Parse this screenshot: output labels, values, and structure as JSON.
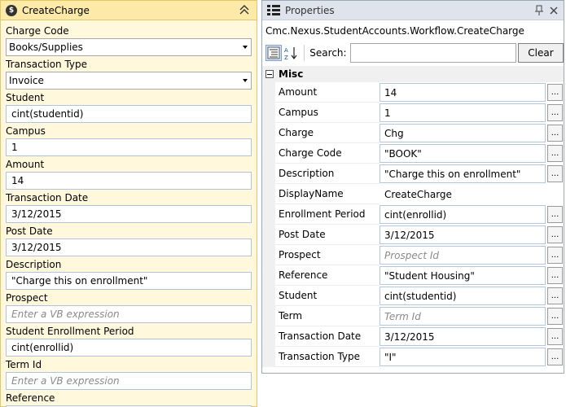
{
  "activity": {
    "title": "CreateCharge",
    "icon_letter": "$",
    "fields": [
      {
        "label": "Charge Code",
        "value": "Books/Supplies",
        "kind": "combo"
      },
      {
        "label": "Transaction Type",
        "value": "Invoice",
        "kind": "combo"
      },
      {
        "label": "Student",
        "value": "cint(studentid)",
        "kind": "text"
      },
      {
        "label": "Campus",
        "value": "1",
        "kind": "text"
      },
      {
        "label": "Amount",
        "value": "14",
        "kind": "text"
      },
      {
        "label": "Transaction Date",
        "value": "3/12/2015",
        "kind": "text"
      },
      {
        "label": "Post Date",
        "value": "3/12/2015",
        "kind": "text"
      },
      {
        "label": "Description",
        "value": "\"Charge this on enrollment\"",
        "kind": "text"
      },
      {
        "label": "Prospect",
        "value": "",
        "placeholder": "Enter a VB expression",
        "kind": "text"
      },
      {
        "label": "Student Enrollment Period",
        "value": "cint(enrollid)",
        "kind": "text"
      },
      {
        "label": "Term Id",
        "value": "",
        "placeholder": "Enter a VB expression",
        "kind": "text"
      },
      {
        "label": "Reference",
        "value": "\"Student Housing\"",
        "kind": "text"
      }
    ]
  },
  "properties": {
    "title": "Properties",
    "object_name": "Cmc.Nexus.StudentAccounts.Workflow.CreateCharge",
    "search_label": "Search:",
    "search_value": "",
    "clear_label": "Clear",
    "category": "Misc",
    "ellipsis": "...",
    "rows": [
      {
        "name": "Amount",
        "value": "14",
        "style": "box"
      },
      {
        "name": "Campus",
        "value": "1",
        "style": "box"
      },
      {
        "name": "Charge",
        "value": "Chg",
        "style": "box"
      },
      {
        "name": "Charge Code",
        "value": "\"BOOK\"",
        "style": "box"
      },
      {
        "name": "Description",
        "value": "\"Charge this on enrollment\"",
        "style": "box"
      },
      {
        "name": "DisplayName",
        "value": "CreateCharge",
        "style": "plain"
      },
      {
        "name": "Enrollment Period",
        "value": "cint(enrollid)",
        "style": "box"
      },
      {
        "name": "Post Date",
        "value": "3/12/2015",
        "style": "box"
      },
      {
        "name": "Prospect",
        "value": "",
        "placeholder": "Prospect Id",
        "style": "box"
      },
      {
        "name": "Reference",
        "value": "\"Student Housing\"",
        "style": "box"
      },
      {
        "name": "Student",
        "value": "cint(studentid)",
        "style": "box"
      },
      {
        "name": "Term",
        "value": "",
        "placeholder": "Term Id",
        "style": "box"
      },
      {
        "name": "Transaction Date",
        "value": "3/12/2015",
        "style": "box"
      },
      {
        "name": "Transaction Type",
        "value": "\"I\"",
        "style": "box"
      }
    ]
  },
  "colors": {
    "activity_bg": "#fff8dd",
    "activity_header": "#fde9a8",
    "activity_border": "#e6c766",
    "props_header": "#dfe4ec"
  }
}
